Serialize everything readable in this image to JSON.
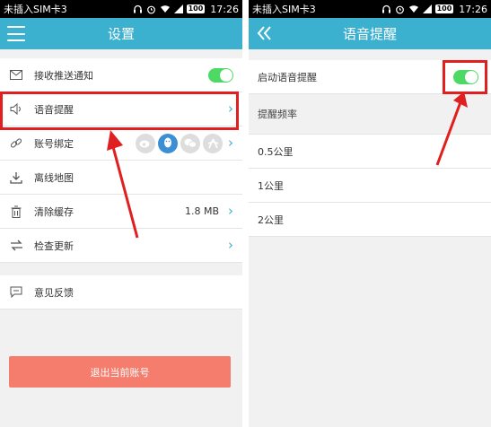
{
  "statusbar": {
    "carrier": "未插入SIM卡3",
    "battery": "100",
    "time": "17:26"
  },
  "left": {
    "title": "设置",
    "push_label": "接收推送通知",
    "voice_label": "语音提醒",
    "account_label": "账号绑定",
    "offline_label": "离线地图",
    "cache_label": "清除缓存",
    "cache_value": "1.8 MB",
    "update_label": "检查更新",
    "feedback_label": "意见反馈",
    "logout_label": "退出当前账号",
    "chevron": "›"
  },
  "right": {
    "title": "语音提醒",
    "enable_label": "启动语音提醒",
    "freq_header": "提醒频率",
    "options": [
      "0.5公里",
      "1公里",
      "2公里"
    ]
  },
  "colors": {
    "accent": "#3bb0cf",
    "toggle_on": "#4cd964",
    "logout": "#f47d6d",
    "highlight": "#e02020"
  },
  "toggles": {
    "push_on": true,
    "voice_on": true
  },
  "icons": [
    "menu-icon",
    "back-icon",
    "mail-icon",
    "speaker-icon",
    "link-icon",
    "download-icon",
    "trash-icon",
    "sync-icon",
    "feedback-icon",
    "weibo-icon",
    "qq-icon",
    "wechat-icon",
    "renren-icon"
  ]
}
